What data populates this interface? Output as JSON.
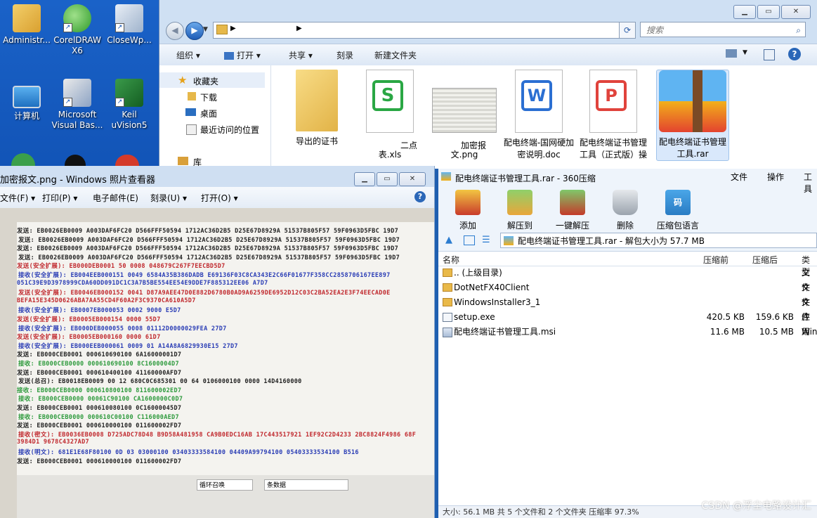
{
  "desktop": {
    "icons": [
      {
        "label": "Administr...",
        "icon": "user-folder-icon"
      },
      {
        "label": "CorelDRAW X6",
        "icon": "coreldraw-icon"
      },
      {
        "label": "CloseWp...",
        "icon": "closewp-icon"
      },
      {
        "label": "计算机",
        "icon": "computer-icon"
      },
      {
        "label": "Microsoft Visual Bas...",
        "icon": "visual-basic-icon"
      },
      {
        "label": "Keil uVision5",
        "icon": "keil-icon"
      }
    ]
  },
  "explorer": {
    "search_placeholder": "搜索",
    "toolbar": {
      "organize": "组织",
      "open": "打开",
      "share": "共享",
      "burn": "刻录",
      "new_folder": "新建文件夹"
    },
    "nav": {
      "favorites": "收藏夹",
      "downloads": "下载",
      "desktop": "桌面",
      "recent": "最近访问的位置",
      "libraries": "库"
    },
    "files": [
      {
        "name": "导出的证书",
        "type": "folder"
      },
      {
        "name": "表.xls",
        "type": "xls",
        "partial": "二点"
      },
      {
        "name": "文.png",
        "type": "png",
        "partial": "加密报"
      },
      {
        "name": "配电终端-国网硬加密说明.doc",
        "type": "doc"
      },
      {
        "name": "配电终端证书管理工具（正式版）操作手册",
        "type": "pdf"
      },
      {
        "name": "配电终端证书管理工具.rar",
        "type": "rar"
      }
    ]
  },
  "viewer": {
    "title": "加密报文.png - Windows 照片查看器",
    "menu": {
      "file": "文件(F)",
      "print": "打印(P)",
      "email": "电子邮件(E)",
      "burn": "刻录(U)",
      "open": "打开(O)"
    },
    "log_lines": [
      {
        "text": "发送: EB0026EB0009 A003DAF6FC20 D566FFF50594 1712AC36D2B5 D25E67D8929A 51537B805F57 59F0963D5FBC 19D7",
        "color": "#222222"
      },
      {
        "text": "发送: EB0026EB0009 A003DAF6FC20 D566FFF50594 1712AC36D2B5 D25E67D8929A 51537B805F57 59F0963D5FBC 19D7",
        "color": "#222222"
      },
      {
        "text": "发送: EB0026EB0009 A003DAF6FC20 D566FFF50594 1712AC36D2B5 D25E67D8929A 51537B805F57 59F0963D5FBC 19D7",
        "color": "#222222"
      },
      {
        "text": "发送: EB0026EB0009 A003DAF6FC20 D566FFF50594 1712AC36D2B5 D25E67D8929A 51537B805F57 59F0963D5FBC 19D7",
        "color": "#222222"
      },
      {
        "text": "发送(安全扩展): EB000DEB0001 50 0008 048679C267F7EECBD5D7",
        "color": "#c0282d"
      },
      {
        "text": "接收(安全扩展): EB004EEB000151 0049 6584A35B386DADB E69136F03C8CA343E2C66F01677F358CC2858706167EE897",
        "color": "#2a3db5"
      },
      {
        "text": "051C39E9D3978999CDA60DD091DC1C3A7B5BE554EE54E9DDE7F885312EE06 A7D7",
        "color": "#2a3db5"
      },
      {
        "text": "发送(安全扩展): EB0046EB000152 0041 D87A9AEE47D0E882D6780B0AD9A6259DE6952D12C03C2BA52EA2E3F74EECAD0E",
        "color": "#c0282d"
      },
      {
        "text": "BEFA15E345D0626ABA7AA55CD4F60A2F3C9370CA610A5D7",
        "color": "#c0282d"
      },
      {
        "text": "接收(安全扩展): EB0007EB000053 0002 9000 E5D7",
        "color": "#2a3db5"
      },
      {
        "text": "发送(安全扩展): EB0005EB000154 0000 55D7",
        "color": "#c0282d"
      },
      {
        "text": "接收(安全扩展): EB000DEB000055 0008 01112D0000029FEA 27D7",
        "color": "#2a3db5"
      },
      {
        "text": "发送(安全扩展): EB0005EB000160 0000 61D7",
        "color": "#c0282d"
      },
      {
        "text": "接收(安全扩展): EB000EEB000061 0009 01 A14A8A6829930E15 27D7",
        "color": "#2a3db5"
      },
      {
        "text": "发送: EB000CEB0001 000610690100 6A16000001D7",
        "color": "#222222"
      },
      {
        "text": "接收: EB000CEB0000 000610690100 8C1600004D7",
        "color": "#2d9a3c"
      },
      {
        "text": "发送: EB000CEB0001 000610400100 41160000AFD7",
        "color": "#222222"
      },
      {
        "text": "发送(总召): EB0018EB0009 00 12 680C0C685301 00 64 0106000100 0000 14D4160000",
        "color": "#222222"
      },
      {
        "text": "接收: EB000CEB0000 000610800100 811600002ED7",
        "color": "#2d9a3c"
      },
      {
        "text": "接收: EB000CEB0000 00061C90100 CA1600000C0D7",
        "color": "#2d9a3c"
      },
      {
        "text": "发送: EB000CEB0001 000610080100 0C16000045D7",
        "color": "#222222"
      },
      {
        "text": "接收: EB000CEB0000 000610C00100 C116000AED7",
        "color": "#2d9a3c"
      },
      {
        "text": "发送: EB000CEB0001 000610000100 011600002FD7",
        "color": "#222222"
      },
      {
        "text": "接收(密文): EB0036EB0008 D725ADC78D48 B9D58A481958 CA9B0EDC16AB 17C443517921 1EF92C2D4233 2BC8824F4986 68F",
        "color": "#c0282d"
      },
      {
        "text": "3984D1 9678C4327AD7",
        "color": "#c0282d"
      },
      {
        "text": "接收(明文): 681E1E68F80100 0D 03 03000100 03403333584100 04409A99794100 05403333534100 B516",
        "color": "#2a3db5"
      },
      {
        "text": "发送: EB000CEB0001 000610000100 011600002FD7",
        "color": "#222222"
      }
    ],
    "controls": {
      "mode": "循环召唤",
      "count": "条数据"
    }
  },
  "zip": {
    "title": "配电终端证书管理工具.rar - 360压缩",
    "menu": {
      "file": "文件",
      "ops": "操作",
      "tools": "工具"
    },
    "tools": [
      {
        "label": "添加",
        "icon": "add-archive-icon"
      },
      {
        "label": "解压到",
        "icon": "extract-to-icon"
      },
      {
        "label": "一键解压",
        "icon": "one-click-extract-icon"
      },
      {
        "label": "删除",
        "icon": "delete-icon"
      },
      {
        "label": "压缩包语言",
        "icon": "archive-language-icon"
      }
    ],
    "path": "配电终端证书管理工具.rar - 解包大小为 57.7 MB",
    "headers": {
      "name": "名称",
      "packed_before": "压缩前",
      "packed_after": "压缩后",
      "type": "类型"
    },
    "rows": [
      {
        "name": ".. (上级目录)",
        "before": "",
        "after": "",
        "type": "文件",
        "kind": "folder"
      },
      {
        "name": "DotNetFX40Client",
        "before": "",
        "after": "",
        "type": "文件",
        "kind": "folder"
      },
      {
        "name": "WindowsInstaller3_1",
        "before": "",
        "after": "",
        "type": "文件",
        "kind": "folder"
      },
      {
        "name": "setup.exe",
        "before": "420.5 KB",
        "after": "159.6 KB",
        "type": "应用",
        "kind": "exe"
      },
      {
        "name": "配电终端证书管理工具.msi",
        "before": "11.6 MB",
        "after": "10.5 MB",
        "type": "Win",
        "kind": "msi"
      }
    ],
    "status": "大小: 56.1 MB 共 5 个文件和 2 个文件夹 压缩率 97.3%"
  },
  "watermark": "CSDN @浮尘电路设计汇"
}
